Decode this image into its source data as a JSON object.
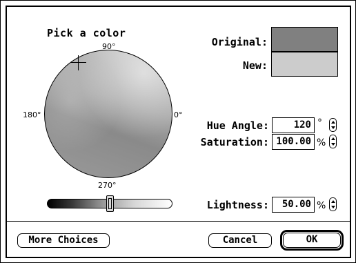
{
  "picker": {
    "title": "Pick a color",
    "degrees": {
      "top": "90°",
      "left": "180°",
      "right": "0°",
      "bottom": "270°"
    },
    "lightness_slider_fraction": 0.5
  },
  "swatches": {
    "original_label": "Original:",
    "new_label": "New:",
    "original_color": "#808080",
    "new_color": "#cccccc"
  },
  "fields": {
    "hue_label": "Hue Angle:",
    "hue_value": "120",
    "hue_unit": "°",
    "saturation_label": "Saturation:",
    "saturation_value": "100.00",
    "saturation_unit": "%",
    "lightness_label": "Lightness:",
    "lightness_value": "50.00",
    "lightness_unit": "%"
  },
  "buttons": {
    "more_choices": "More Choices",
    "cancel": "Cancel",
    "ok": "OK"
  },
  "icons": {
    "stepper": "up-down-arrows-icon",
    "crosshair": "crosshair-icon"
  }
}
